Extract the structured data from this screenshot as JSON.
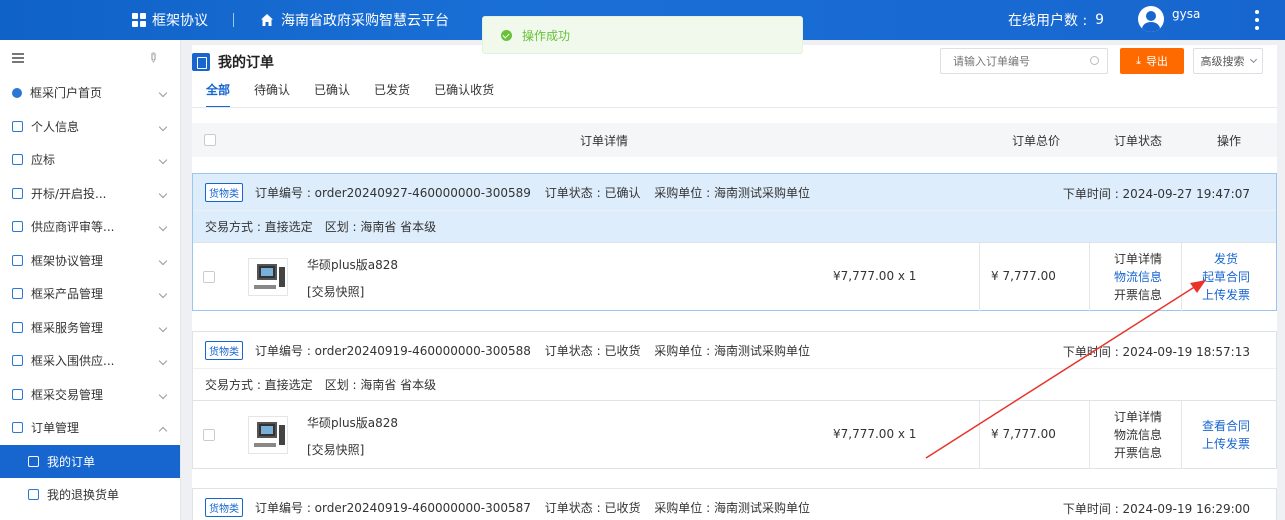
{
  "header": {
    "module": "框架协议",
    "platform": "海南省政府采购智慧云平台",
    "online_label": "在线用户数 :",
    "online_count": "9",
    "username": "gysa"
  },
  "toast": {
    "message": "操作成功"
  },
  "sidebar": {
    "items": [
      {
        "label": "框采门户首页"
      },
      {
        "label": "个人信息"
      },
      {
        "label": "应标"
      },
      {
        "label": "开标/开启投..."
      },
      {
        "label": "供应商评审等..."
      },
      {
        "label": "框架协议管理"
      },
      {
        "label": "框采产品管理"
      },
      {
        "label": "框采服务管理"
      },
      {
        "label": "框采入围供应..."
      },
      {
        "label": "框采交易管理"
      },
      {
        "label": "订单管理"
      }
    ],
    "sub_items": [
      {
        "label": "我的订单"
      },
      {
        "label": "我的退换货单"
      }
    ]
  },
  "main": {
    "title": "我的订单",
    "search_placeholder": "请输入订单编号",
    "export_label": "导出",
    "advanced_label": "高级搜索",
    "tabs": [
      "全部",
      "待确认",
      "已确认",
      "已发货",
      "已确认收货"
    ],
    "table_headers": {
      "detail": "订单详情",
      "total": "订单总价",
      "status": "订单状态",
      "ops": "操作"
    }
  },
  "orders": [
    {
      "badge": "货物类",
      "order_no": "订单编号 : order20240927-460000000-300589",
      "status": "订单状态 : 已确认",
      "buyer": "采购单位 : 海南测试采购单位",
      "time": "下单时间 : 2024-09-27 19:47:07",
      "trade": "交易方式 : 直接选定",
      "region": "区划 : 海南省 省本级",
      "product": "华硕plus版a828",
      "snapshot": "[交易快照]",
      "price": "¥7,777.00 x 1",
      "total": "¥ 7,777.00",
      "status_links": [
        "订单详情",
        "物流信息",
        "开票信息"
      ],
      "ops": [
        "发货",
        "起草合同",
        "上传发票"
      ]
    },
    {
      "badge": "货物类",
      "order_no": "订单编号 : order20240919-460000000-300588",
      "status": "订单状态 : 已收货",
      "buyer": "采购单位 : 海南测试采购单位",
      "time": "下单时间 : 2024-09-19 18:57:13",
      "trade": "交易方式 : 直接选定",
      "region": "区划 : 海南省 省本级",
      "product": "华硕plus版a828",
      "snapshot": "[交易快照]",
      "price": "¥7,777.00 x 1",
      "total": "¥ 7,777.00",
      "status_links": [
        "订单详情",
        "物流信息",
        "开票信息"
      ],
      "ops": [
        "查看合同",
        "上传发票"
      ]
    },
    {
      "badge": "货物类",
      "order_no": "订单编号 : order20240919-460000000-300587",
      "status": "订单状态 : 已收货",
      "buyer": "采购单位 : 海南测试采购单位",
      "time": "下单时间 : 2024-09-19 16:29:00"
    }
  ],
  "colors": {
    "primary": "#1766cf",
    "export": "#ff6a00",
    "toast": "#67c23a",
    "annotation": "#e8332a"
  }
}
